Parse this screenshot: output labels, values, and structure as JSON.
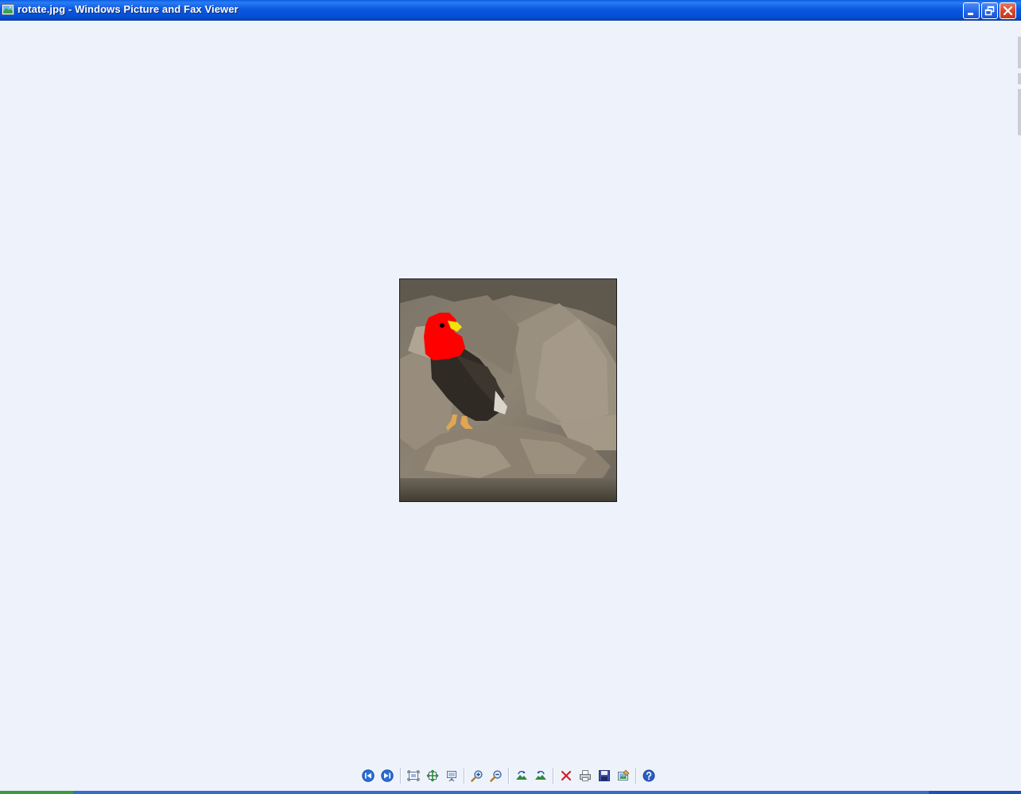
{
  "window": {
    "title": "rotate.jpg - Windows Picture and Fax Viewer"
  },
  "colors": {
    "titlebar": "#0b57e0",
    "viewer_background": "#eef3fb",
    "close_button": "#d4462a"
  },
  "image": {
    "file": "rotate.jpg",
    "subject": "eagle-with-red-painted-head"
  },
  "toolbar": {
    "icons": [
      "previous-image-icon",
      "next-image-icon",
      "best-fit-icon",
      "actual-size-icon",
      "slideshow-icon",
      "zoom-in-icon",
      "zoom-out-icon",
      "rotate-clockwise-icon",
      "rotate-counterclockwise-icon",
      "delete-icon",
      "print-icon",
      "save-icon",
      "open-for-editing-icon",
      "help-icon"
    ]
  }
}
